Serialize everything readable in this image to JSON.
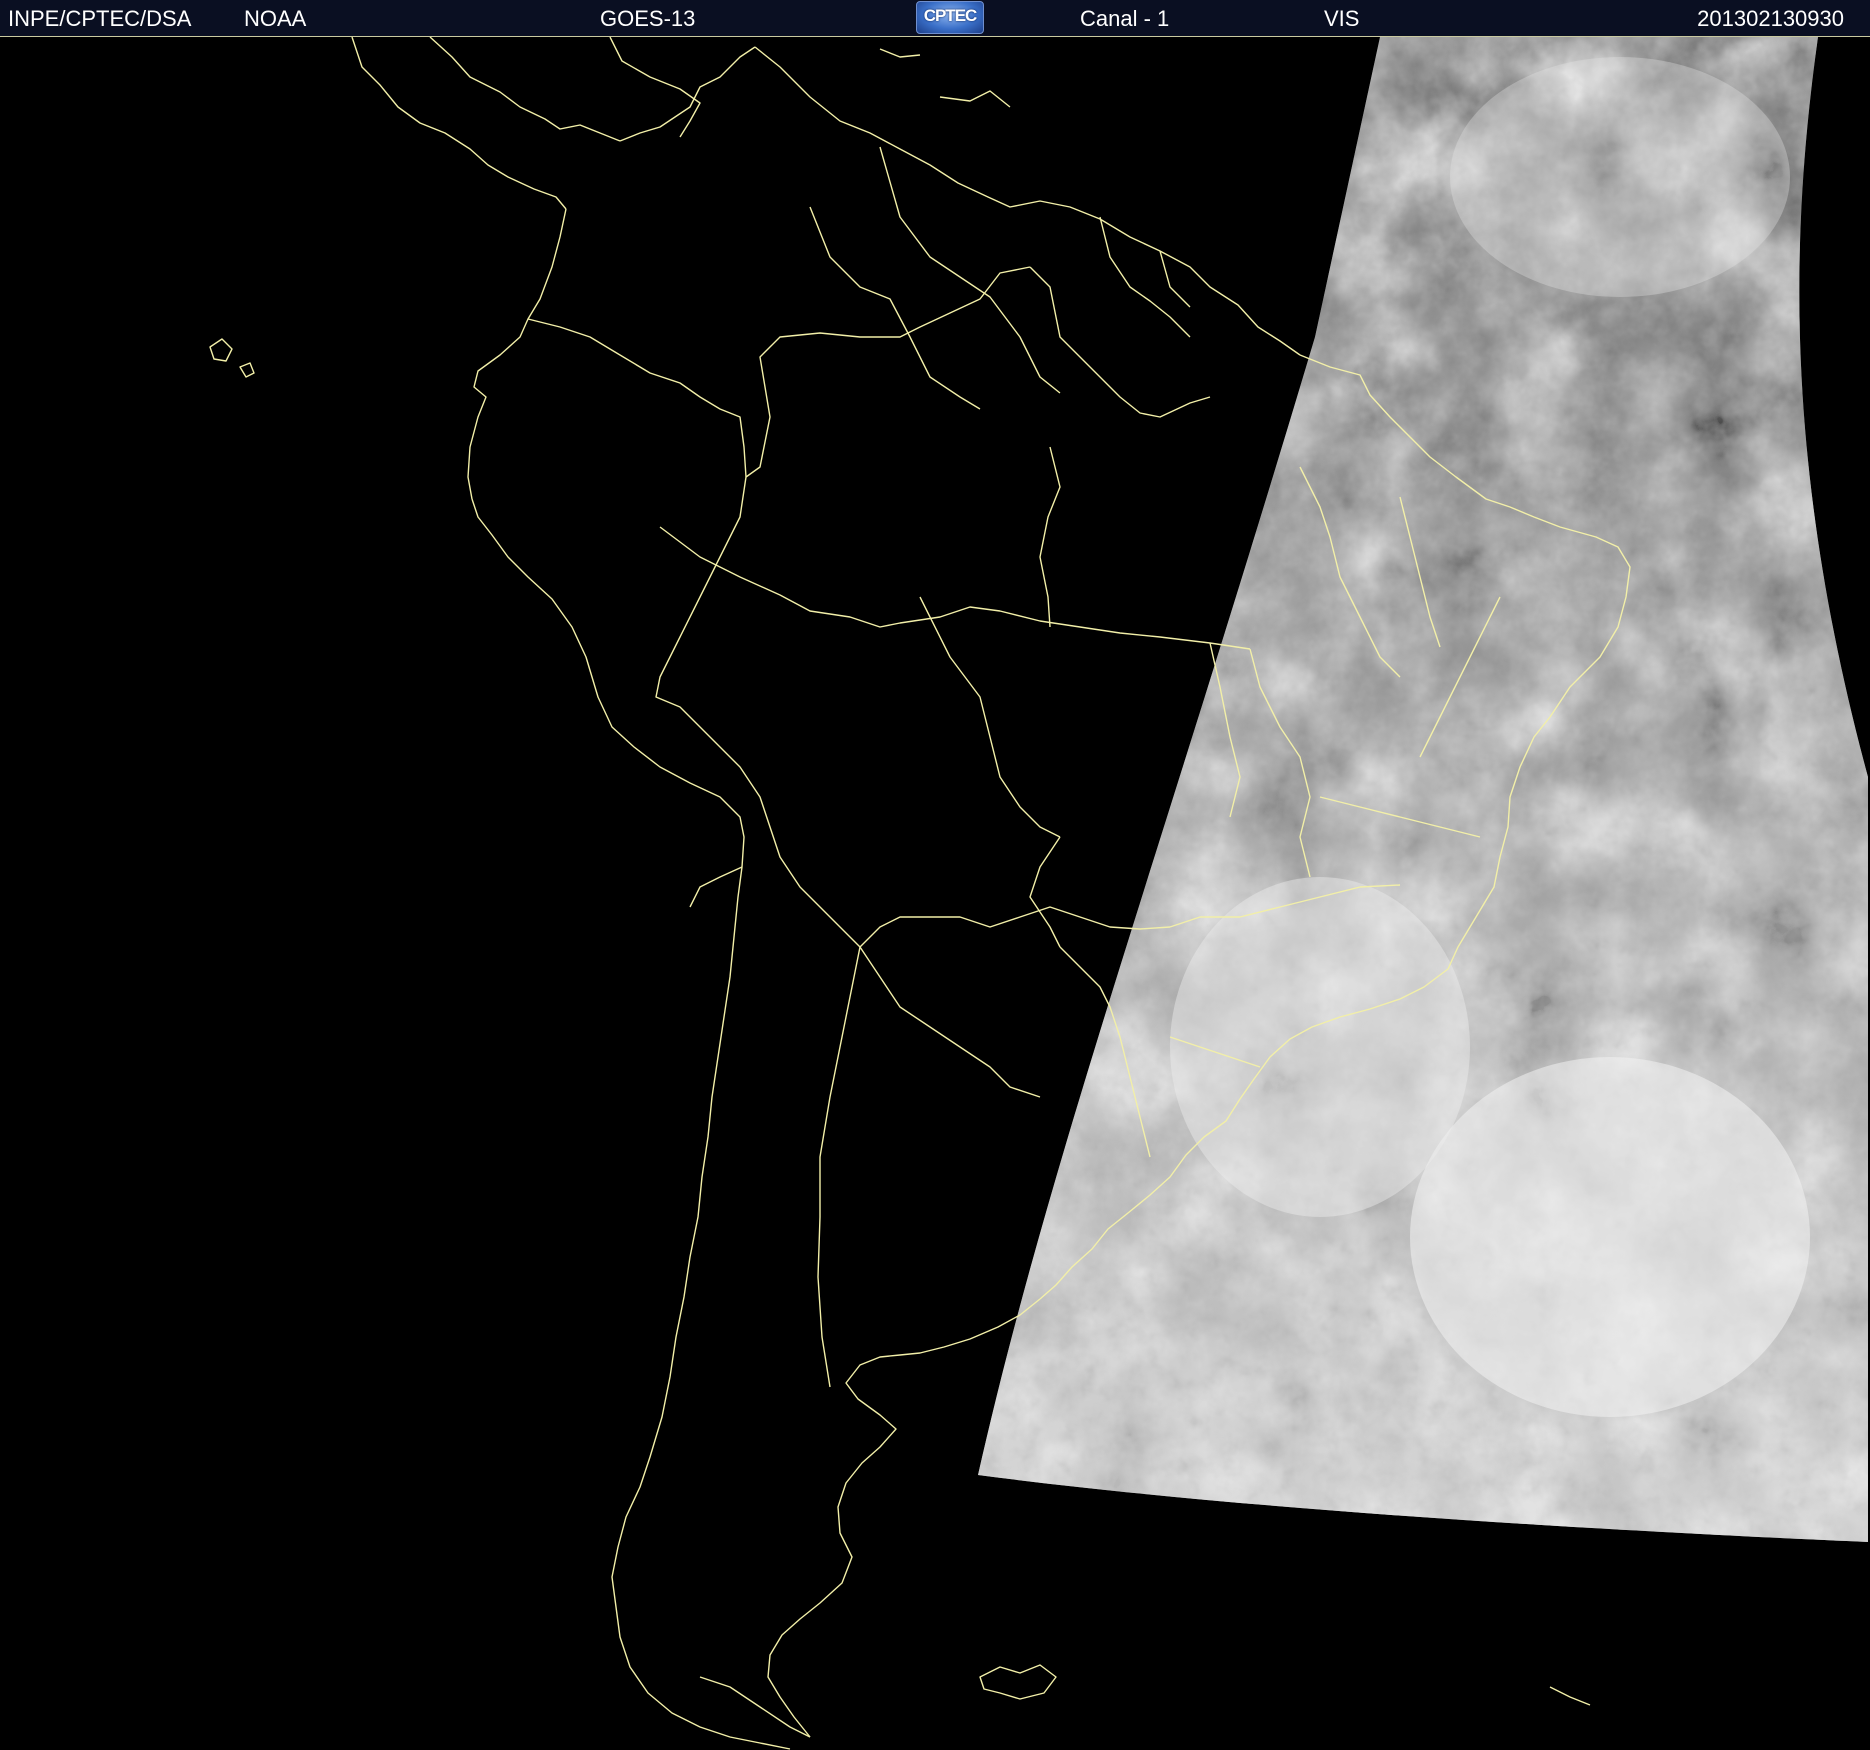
{
  "header": {
    "organization": "INPE/CPTEC/DSA",
    "agency": "NOAA",
    "satellite": "GOES-13",
    "logo_text": "CPTEC",
    "channel": "Canal - 1",
    "band": "VIS",
    "timestamp": "201302130930"
  },
  "colors": {
    "background": "#000000",
    "header_bg": "#0a0f22",
    "coastline": "#f2efa8",
    "cloud_bright": "#f4f4f4",
    "cloud_mid": "#9a9a9a",
    "ocean_gray": "#6e6e6e"
  }
}
